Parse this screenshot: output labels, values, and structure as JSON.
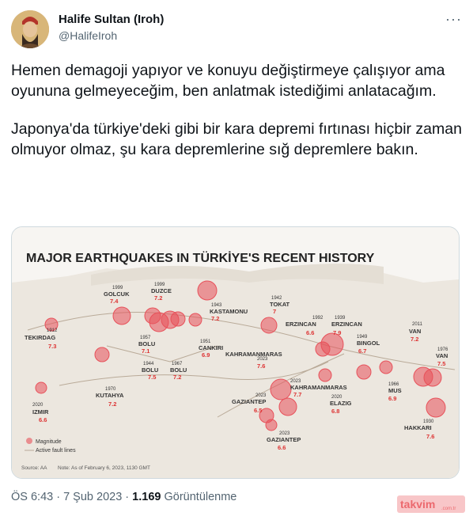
{
  "author": {
    "name": "Halife Sultan (Iroh)",
    "handle": "@HalifeIroh"
  },
  "more_label": "···",
  "tweet": {
    "paragraph1": "Hemen demagoji yapıyor ve konuyu değiştirmeye çalışıyor ama oyununa gelmeyeceğim, ben anlatmak istediğimi anlatacağım.",
    "paragraph2": "Japonya'da türkiye'deki gibi bir kara depremi fırtınası hiçbir zaman olmuyor olmaz, şu kara depremlerine sığ depremlere bakın."
  },
  "map": {
    "title": "MAJOR EARTHQUAKES IN TÜRKİYE'S RECENT HISTORY",
    "legend_magnitude": "Magnitude",
    "legend_faults": "Active fault lines",
    "source": "Source: AA",
    "note": "Note: As of February 6, 2023, 1130 GMT",
    "quakes": [
      {
        "year": "1999",
        "place": "GOLCUK",
        "mag": "7.4"
      },
      {
        "year": "1999",
        "place": "DUZCE",
        "mag": "7.2"
      },
      {
        "year": "1942",
        "place": "TOKAT",
        "mag": "7"
      },
      {
        "year": "1943",
        "place": "KASTAMONU",
        "mag": "7.2"
      },
      {
        "year": "1912",
        "place": "TEKIRDAG",
        "mag": "7.3"
      },
      {
        "year": "1957",
        "place": "BOLU",
        "mag": "7.1"
      },
      {
        "year": "1944",
        "place": "BOLU",
        "mag": "7.5"
      },
      {
        "year": "1967",
        "place": "BOLU",
        "mag": "7.2"
      },
      {
        "year": "1951",
        "place": "CANKIRI",
        "mag": "6.9"
      },
      {
        "year": "1992",
        "place": "ERZINCAN",
        "mag": "6.6"
      },
      {
        "year": "1939",
        "place": "ERZINCAN",
        "mag": "7.9"
      },
      {
        "year": "2011",
        "place": "VAN",
        "mag": "7.2"
      },
      {
        "year": "1976",
        "place": "VAN",
        "mag": "7.5"
      },
      {
        "year": "1949",
        "place": "BINGOL",
        "mag": "6.7"
      },
      {
        "year": "2023",
        "place": "KAHRAMANMARAS",
        "mag": "7.6"
      },
      {
        "year": "2023",
        "place": "KAHRAMANMARAS",
        "mag": "7.7"
      },
      {
        "year": "1970",
        "place": "KUTAHYA",
        "mag": "7.2"
      },
      {
        "year": "2020",
        "place": "IZMIR",
        "mag": "6.6"
      },
      {
        "year": "2023",
        "place": "GAZIANTEP",
        "mag": "6.5"
      },
      {
        "year": "2020",
        "place": "ELAZIG",
        "mag": "6.8"
      },
      {
        "year": "1966",
        "place": "MUS",
        "mag": "6.9"
      },
      {
        "year": "1930",
        "place": "HAKKARI",
        "mag": "7.6"
      },
      {
        "year": "2023",
        "place": "GAZIANTEP",
        "mag": "6.6"
      }
    ]
  },
  "meta": {
    "time": "ÖS 6:43 · 7 Şub 2023 ·",
    "views_count": "1.169",
    "views_label": "Görüntülenme"
  },
  "watermark": "takvim.com.tr",
  "colors": {
    "quake": "#e8515a",
    "map_land": "#ece7df",
    "sea": "#f7f5f2",
    "handle": "#536471"
  }
}
